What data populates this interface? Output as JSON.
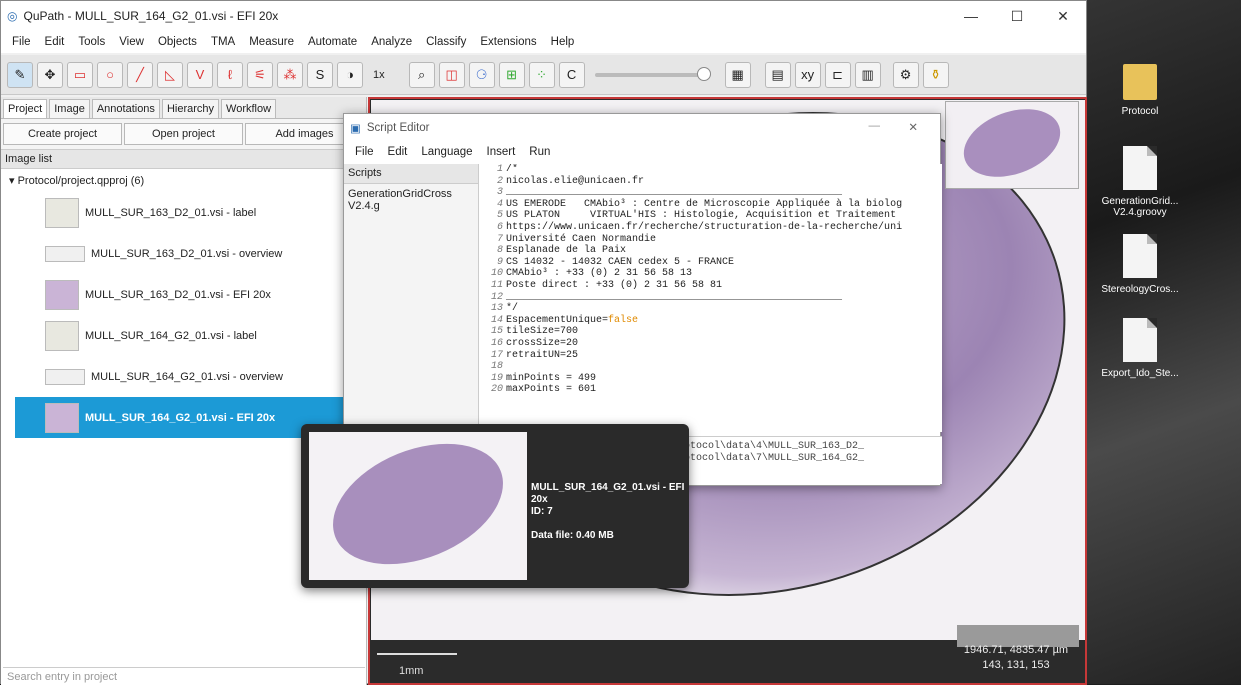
{
  "window": {
    "title": "QuPath - MULL_SUR_164_G2_01.vsi - EFI 20x",
    "minimize": "—",
    "maximize": "☐",
    "close": "✕"
  },
  "menu": [
    "File",
    "Edit",
    "Tools",
    "View",
    "Objects",
    "TMA",
    "Measure",
    "Automate",
    "Analyze",
    "Classify",
    "Extensions",
    "Help"
  ],
  "toolbar": {
    "zoom_label": "1x"
  },
  "left_tabs": [
    "Project",
    "Image",
    "Annotations",
    "Hierarchy",
    "Workflow"
  ],
  "project_buttons": [
    "Create project",
    "Open project",
    "Add images"
  ],
  "image_list": {
    "header": "Image list",
    "root": "▾ Protocol/project.qpproj (6)",
    "items": [
      {
        "label": "MULL_SUR_163_D2_01.vsi - label",
        "kind": "label"
      },
      {
        "label": "MULL_SUR_163_D2_01.vsi - overview",
        "kind": "over"
      },
      {
        "label": "MULL_SUR_163_D2_01.vsi - EFI 20x",
        "kind": "tissue"
      },
      {
        "label": "MULL_SUR_164_G2_01.vsi - label",
        "kind": "label"
      },
      {
        "label": "MULL_SUR_164_G2_01.vsi - overview",
        "kind": "over"
      },
      {
        "label": "MULL_SUR_164_G2_01.vsi - EFI 20x",
        "kind": "tissue",
        "selected": true
      }
    ]
  },
  "search_placeholder": "Search entry in project",
  "viewer": {
    "scale": "1mm",
    "coord_line1": "1946.71, 4835.47 µm",
    "coord_line2": "143, 131, 153"
  },
  "script_editor": {
    "title": "Script Editor",
    "menu": [
      "File",
      "Edit",
      "Language",
      "Insert",
      "Run"
    ],
    "scripts_header": "Scripts",
    "scripts": [
      "GenerationGridCross V2.4.g"
    ],
    "lines": [
      {
        "n": "1",
        "t": "/*"
      },
      {
        "n": "2",
        "t": "nicolas.elie@unicaen.fr"
      },
      {
        "n": "3",
        "t": "________________________________________________________"
      },
      {
        "n": "4",
        "t": "US EMERODE   CMAbio³ : Centre de Microscopie Appliquée à la biolog"
      },
      {
        "n": "5",
        "t": "US PLATON     VIRTUAL'HIS : Histologie, Acquisition et Traitement"
      },
      {
        "n": "6",
        "t": "https://www.unicaen.fr/recherche/structuration-de-la-recherche/uni"
      },
      {
        "n": "7",
        "t": "Université Caen Normandie"
      },
      {
        "n": "8",
        "t": "Esplanade de la Paix"
      },
      {
        "n": "9",
        "t": "CS 14032 - 14032 CAEN cedex 5 - FRANCE"
      },
      {
        "n": "10",
        "t": "CMAbio³ : +33 (0) 2 31 56 58 13"
      },
      {
        "n": "11",
        "t": "Poste direct : +33 (0) 2 31 56 58 81"
      },
      {
        "n": "12",
        "t": "________________________________________________________"
      },
      {
        "n": "13",
        "t": "*/"
      },
      {
        "n": "14",
        "t": "EspacementUnique=",
        "kw": "false"
      },
      {
        "n": "15",
        "t": "tileSize=700"
      },
      {
        "n": "16",
        "t": "crossSize=20"
      },
      {
        "n": "17",
        "t": "retraitUN=25"
      },
      {
        "n": "18",
        "t": ""
      },
      {
        "n": "19",
        "t": "minPoints = 499"
      },
      {
        "n": "20",
        "t": "maxPoints = 601"
      }
    ],
    "console": [
      "sult: C:\\Users\\csauger\\Desktop\\Protocol\\data\\4\\MULL_SUR_163_D2_",
      "sult: C:\\Users\\csauger\\Desktop\\Protocol\\data\\7\\MULL_SUR_164_G2_"
    ]
  },
  "tooltip": {
    "name": "MULL_SUR_164_G2_01.vsi - EFI 20x",
    "id": "ID:  7",
    "data": "Data file: 0.40 MB"
  },
  "desktop": [
    {
      "label": "Protocol",
      "folder": true
    },
    {
      "label": "GenerationGrid... V2.4.groovy"
    },
    {
      "label": "StereologyCros..."
    },
    {
      "label": "Export_Ido_Ste..."
    }
  ]
}
